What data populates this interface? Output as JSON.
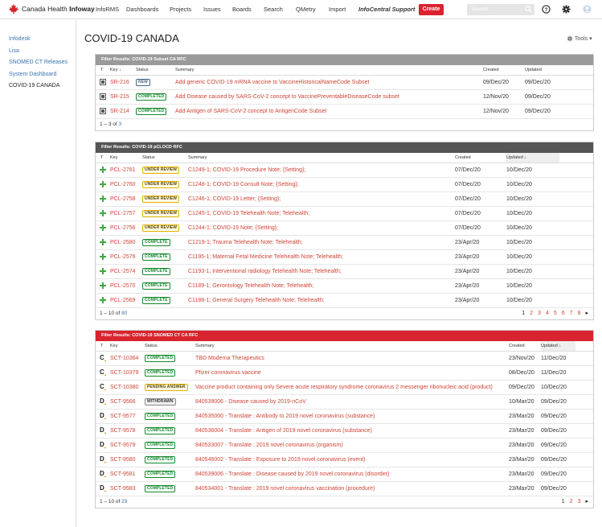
{
  "nav": {
    "logo_text_a": "Canada Health ",
    "logo_text_b": "Infoway",
    "items": [
      "InfoRMS",
      "Dashboards",
      "Projects",
      "Issues",
      "Boards",
      "Search",
      "QMetry",
      "Import",
      "InfoCentral Support"
    ],
    "create": "Create",
    "search_placeholder": "Search"
  },
  "sidebar": [
    "Infodesk",
    "Lisa",
    "SNOMED CT Releases",
    "System Dashboard",
    "COVID-19 CANADA"
  ],
  "page": {
    "title": "COVID-19 CANADA",
    "tools": "Tools"
  },
  "colors": {
    "accent_red": "#d9232e",
    "link": "#d04437",
    "done": "#14892c"
  },
  "gadget1": {
    "title": "Filter Results: COVID-19 Subset CA RFC",
    "headers": {
      "t": "T",
      "key": "Key",
      "status": "Status",
      "summary": "Summary",
      "created": "Created",
      "updated": "Updated"
    },
    "rows": [
      {
        "key": "SR-216",
        "status": "NEW",
        "summary": "Add generic COVID-19 mRNA vaccine to VaccineHistoricalNameCode Subset",
        "created": "09/Dec/20",
        "updated": "09/Dec/20"
      },
      {
        "key": "SR-215",
        "status": "COMPLETED",
        "summary": "Add Disease caused by SARS-CoV-2 concept to VaccinePreventableDiseaseCode subset",
        "created": "12/Nov/20",
        "updated": "09/Dec/20"
      },
      {
        "key": "SR-214",
        "status": "COMPLETED",
        "summary": "Add Antigen of SARS-CoV-2 concept to AntigenCode Subset",
        "created": "12/Nov/20",
        "updated": "09/Dec/20"
      }
    ],
    "footer_a": "1 – 3 of ",
    "footer_b": "3"
  },
  "gadget2": {
    "title": "Filter Results: COVID-19 pCLOCD RFC",
    "headers": {
      "t": "T",
      "key": "Key",
      "status": "Status",
      "summary": "Summary",
      "created": "Created",
      "updated": "Updated"
    },
    "rows": [
      {
        "key": "PCL-2761",
        "status": "UNDER REVIEW",
        "summary": "C1249-1; COVID-19 Procedure Note; {Setting};",
        "created": "07/Dec/20",
        "updated": "10/Dec/20"
      },
      {
        "key": "PCL-2760",
        "status": "UNDER REVIEW",
        "summary": "C1248-1; COVID-19 Consult Note; {Setting};",
        "created": "07/Dec/20",
        "updated": "10/Dec/20"
      },
      {
        "key": "PCL-2758",
        "status": "UNDER REVIEW",
        "summary": "C1246-1; COVID-19 Letter; {Setting};",
        "created": "07/Dec/20",
        "updated": "10/Dec/20"
      },
      {
        "key": "PCL-2757",
        "status": "UNDER REVIEW",
        "summary": "C1245-1; COVID-19 Telehealth Note; Telehealth;",
        "created": "07/Dec/20",
        "updated": "10/Dec/20"
      },
      {
        "key": "PCL-2756",
        "status": "UNDER REVIEW",
        "summary": "C1244-1; COVID-19 Note; {Setting};",
        "created": "07/Dec/20",
        "updated": "10/Dec/20"
      },
      {
        "key": "PCL-2580",
        "status": "COMPLETE",
        "summary": "C1219-1; Trauma Telehealth Note; Telehealth;",
        "created": "23/Apr/20",
        "updated": "10/Dec/20"
      },
      {
        "key": "PCL-2576",
        "status": "COMPLETE",
        "summary": "C1195-1; Maternal Fetal Medicine Telehealth Note; Telehealth;",
        "created": "23/Apr/20",
        "updated": "10/Dec/20"
      },
      {
        "key": "PCL-2574",
        "status": "COMPLETE",
        "summary": "C1193-1; Interventional radiology Telehealth Note; Telehealth;",
        "created": "23/Apr/20",
        "updated": "10/Dec/20"
      },
      {
        "key": "PCL-2570",
        "status": "COMPLETE",
        "summary": "C1189-1; Gerontology Telehealth Note; Telehealth;",
        "created": "23/Apr/20",
        "updated": "10/Dec/20"
      },
      {
        "key": "PCL-2569",
        "status": "COMPLETE",
        "summary": "C1188-1; General Surgery Telehealth Note; Telehealth;",
        "created": "23/Apr/20",
        "updated": "10/Dec/20"
      }
    ],
    "footer_a": "1 – 10 of ",
    "footer_b": "80",
    "pages": [
      "1",
      "2",
      "3",
      "4",
      "5",
      "6",
      "7",
      "8"
    ]
  },
  "gadget3": {
    "title": "Filter Results: COVID-19 SNOMED CT CA RFC",
    "headers": {
      "t": "T",
      "key": "Key",
      "status": "Status",
      "summary": "Summary",
      "created": "Created",
      "updated": "Updated"
    },
    "rows": [
      {
        "type": "C",
        "key": "SCT-10364",
        "status": "COMPLETED",
        "summary": "TBD Moderna Therapeutics",
        "created": "23/Nov/20",
        "updated": "11/Dec/20"
      },
      {
        "type": "C",
        "key": "SCT-10379",
        "status": "COMPLETED",
        "summary": "Pfizer coronavirus vaccine",
        "created": "08/Dec/20",
        "updated": "11/Dec/20"
      },
      {
        "type": "C",
        "key": "SCT-10380",
        "status": "PENDING ANSWER",
        "summary": "Vaccine product containing only Severe acute respiratory syndrome coronavirus 2 messenger ribonucleic acid (product)",
        "created": "09/Dec/20",
        "updated": "10/Dec/20"
      },
      {
        "type": "D",
        "key": "SCT-9566",
        "status": "WITHDRAWN",
        "summary": "840539006 - Disease caused by 2019-nCoV",
        "created": "10/Mar/20",
        "updated": "09/Dec/20"
      },
      {
        "type": "D",
        "key": "SCT-9577",
        "status": "COMPLETED",
        "summary": "840535000 - Translate : Antibody to 2019 novel coronavirus (substance)",
        "created": "23/Mar/20",
        "updated": "09/Dec/20"
      },
      {
        "type": "D",
        "key": "SCT-9578",
        "status": "COMPLETED",
        "summary": "840536004 - Translate : Antigen of 2019 novel coronavirus (substance)",
        "created": "23/Mar/20",
        "updated": "09/Dec/20"
      },
      {
        "type": "D",
        "key": "SCT-9579",
        "status": "COMPLETED",
        "summary": "840533007 - Translate : 2019 novel coronavirus (organism)",
        "created": "23/Mar/20",
        "updated": "09/Dec/20"
      },
      {
        "type": "D",
        "key": "SCT-9580",
        "status": "COMPLETED",
        "summary": "840546002 - Translate : Exposure to 2019 novel coronavirus (event)",
        "created": "23/Mar/20",
        "updated": "09/Dec/20"
      },
      {
        "type": "D",
        "key": "SCT-9581",
        "status": "COMPLETED",
        "summary": "840539006 - Translate : Disease caused by 2019 novel coronavirus (disorder)",
        "created": "23/Mar/20",
        "updated": "09/Dec/20"
      },
      {
        "type": "D",
        "key": "SCT-9583",
        "status": "COMPLETED",
        "summary": "840534001 - Translate : 2019 novel coronavirus vaccination (procedure)",
        "created": "23/Mar/20",
        "updated": "09/Dec/20"
      }
    ],
    "footer_a": "1 – 10 of ",
    "footer_b": "29",
    "pages": [
      "1",
      "2",
      "3"
    ]
  }
}
